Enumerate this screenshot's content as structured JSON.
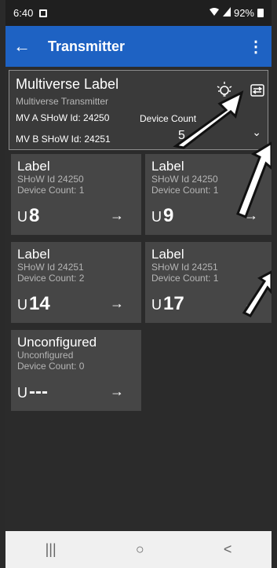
{
  "status": {
    "time": "6:40",
    "battery": "92%"
  },
  "appbar": {
    "back_icon": "←",
    "title": "Transmitter",
    "more_icon": "⋮"
  },
  "summary": {
    "title": "Multiverse Label",
    "subtitle": "Multiverse Transmitter",
    "mv_a": "MV A SHoW Id: 24250",
    "mv_b": "MV B SHoW Id: 24251",
    "device_count_label": "Device Count",
    "device_count_value": "5",
    "chevron_icon": "⌄"
  },
  "tiles": [
    {
      "label": "Label",
      "show_id": "SHoW Id 24250",
      "device_count": "Device Count: 1",
      "universe_prefix": "U",
      "universe": "8",
      "arrow": "→"
    },
    {
      "label": "Label",
      "show_id": "SHoW Id 24250",
      "device_count": "Device Count: 1",
      "universe_prefix": "U",
      "universe": "9",
      "arrow": "→"
    },
    {
      "label": "Label",
      "show_id": "SHoW Id 24251",
      "device_count": "Device Count: 2",
      "universe_prefix": "U",
      "universe": "14",
      "arrow": "→"
    },
    {
      "label": "Label",
      "show_id": "SHoW Id 24251",
      "device_count": "Device Count: 1",
      "universe_prefix": "U",
      "universe": "17",
      "arrow": "→"
    },
    {
      "label": "Unconfigured",
      "show_id": "Unconfigured",
      "device_count": "Device Count: 0",
      "universe_prefix": "U",
      "universe": "---",
      "arrow": "→"
    }
  ],
  "navbar": {
    "recents_icon": "|||",
    "home_icon": "○",
    "back_icon": "<"
  }
}
